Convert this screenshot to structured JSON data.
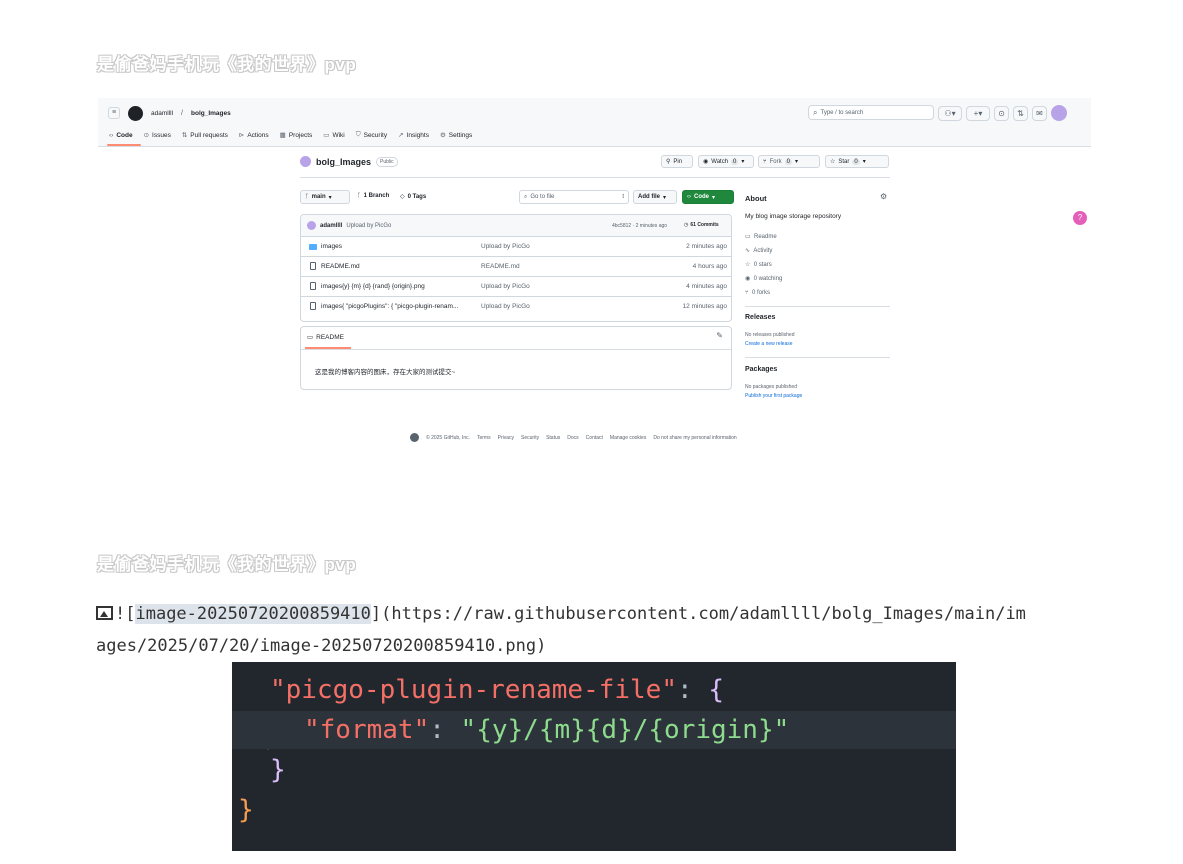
{
  "watermark": {
    "text": "是偷爸妈手机玩《我的世界》pvp"
  },
  "github": {
    "user": "adamllll",
    "slash": "/",
    "repo": "bolg_Images",
    "search_placeholder": "Type / to search",
    "nav_tabs": [
      {
        "label": "Code",
        "icon": "code-icon"
      },
      {
        "label": "Issues",
        "icon": "issue-icon"
      },
      {
        "label": "Pull requests",
        "icon": "pull-request-icon"
      },
      {
        "label": "Actions",
        "icon": "play-icon"
      },
      {
        "label": "Projects",
        "icon": "table-icon"
      },
      {
        "label": "Wiki",
        "icon": "book-icon"
      },
      {
        "label": "Security",
        "icon": "shield-icon"
      },
      {
        "label": "Insights",
        "icon": "graph-icon"
      },
      {
        "label": "Settings",
        "icon": "gear-icon"
      }
    ],
    "repo_title": "bolg_Images",
    "visibility": "Public",
    "pin": "Pin",
    "watch": "Watch",
    "watch_count": "0",
    "fork": "Fork",
    "fork_count": "0",
    "star": "Star",
    "star_count": "0",
    "branch": "main",
    "branches": "1 Branch",
    "tags": "0 Tags",
    "goto_placeholder": "Go to file",
    "goto_key": "t",
    "add_file": "Add file",
    "code_btn": "Code",
    "commit": {
      "author": "adamllll",
      "message": "Upload by PicGo",
      "meta": "4bc5812 · 2 minutes ago",
      "commits": "61 Commits"
    },
    "files": [
      {
        "name": "images",
        "message": "Upload by PicGo",
        "time": "2 minutes ago",
        "type": "folder"
      },
      {
        "name": "README.md",
        "message": "README.md",
        "time": "4 hours ago",
        "type": "file"
      },
      {
        "name": "images{y} {m} {d} {rand} {origin}.png",
        "message": "Upload by PicGo",
        "time": "4 minutes ago",
        "type": "file"
      },
      {
        "name": "images{ \"picgoPlugins\": { \"picgo-plugin-renam...",
        "message": "Upload by PicGo",
        "time": "12 minutes ago",
        "type": "file"
      }
    ],
    "readme_tab": "README",
    "readme_text": "这是我的博客内容的图床，存在大家的测试提交~",
    "about": {
      "title": "About",
      "desc": "My blog image storage repository",
      "items": [
        {
          "icon": "book-icon",
          "label": "Readme"
        },
        {
          "icon": "pulse-icon",
          "label": "Activity"
        },
        {
          "icon": "star-icon",
          "label": "0 stars"
        },
        {
          "icon": "eye-icon",
          "label": "0 watching"
        },
        {
          "icon": "fork-icon",
          "label": "0 forks"
        }
      ],
      "releases_title": "Releases",
      "releases_text": "No releases published",
      "releases_link": "Create a new release",
      "packages_title": "Packages",
      "packages_text": "No packages published",
      "packages_link": "Publish your first package"
    },
    "footer": [
      "© 2025 GitHub, Inc.",
      "Terms",
      "Privacy",
      "Security",
      "Status",
      "Docs",
      "Contact",
      "Manage cookies",
      "Do not share my personal information"
    ]
  },
  "markdown": {
    "image_icon": "image-icon",
    "prefix": "![",
    "alt": "image-20250720200859410",
    "middle": "](https://raw.githubusercontent.com/adamllll/bolg_Images/main/im",
    "line2": "ages/2025/07/20/image-20250720200859410.png)"
  },
  "code": {
    "line1_key": "\"picgo-plugin-rename-file\"",
    "colon": ":",
    "brace_open": "{",
    "line2_key": "\"format\"",
    "line2_val": "\"{y}/{m}{d}/{origin}\"",
    "brace_close": "}",
    "outer_close": "}"
  },
  "colors": {
    "accent_green": "#1f883d",
    "link": "#0969da",
    "code_bg": "#22272e",
    "tab_underline": "#fd8c73"
  }
}
